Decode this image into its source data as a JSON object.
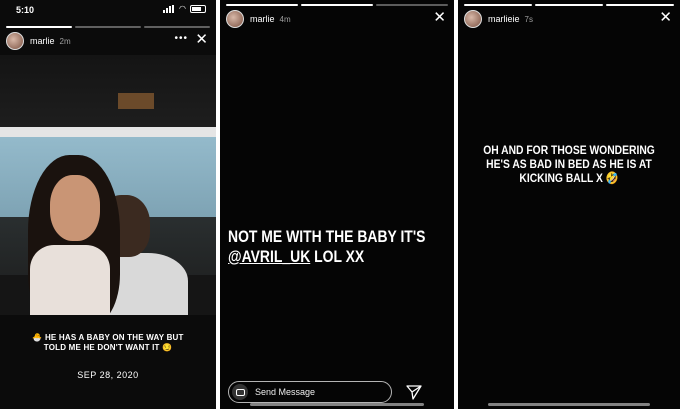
{
  "status_bar": {
    "time": "5:10"
  },
  "panel1": {
    "username": "marlie",
    "time_ago": "2m",
    "more_label": "•••",
    "close_label": "✕",
    "caption": "🐣 HE HAS A BABY ON THE WAY BUT TOLD ME HE DON'T WANT IT 😏",
    "date": "SEP 28, 2020"
  },
  "panel2": {
    "username": "marlie",
    "time_ago": "4m",
    "close_label": "✕",
    "story_text_line1": "NOT ME WITH THE BABY IT'S",
    "mention": "@AVRIL_UK",
    "story_text_line2_rest": " LOL XX",
    "send_placeholder": "Send Message"
  },
  "panel3": {
    "username": "marlieie",
    "time_ago": "7s",
    "close_label": "✕",
    "story_text": "OH AND FOR THOSE WONDERING HE'S AS BAD IN BED AS HE IS AT KICKING BALL X 🤣"
  },
  "colors": {
    "story_bg": "#000000",
    "text": "#ffffff"
  }
}
